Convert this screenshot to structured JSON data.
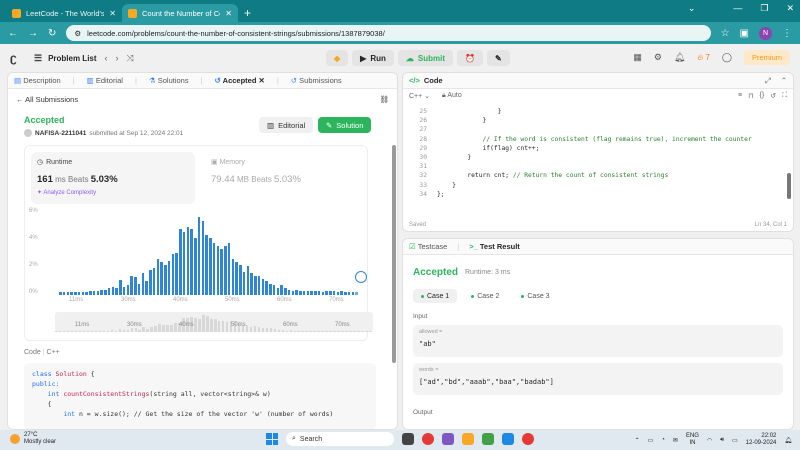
{
  "browser": {
    "tabs": [
      {
        "title": "LeetCode - The World's Leadin",
        "active": false
      },
      {
        "title": "Count the Number of Consistent",
        "active": true
      }
    ],
    "url": "leetcode.com/problems/count-the-number-of-consistent-strings/submissions/1387879038/",
    "profile_initial": "N"
  },
  "toolbar": {
    "problem_list": "Problem List",
    "run": "Run",
    "submit": "Submit",
    "streak": "7",
    "premium": "Premium"
  },
  "left": {
    "tabs": [
      "Description",
      "Editorial",
      "Solutions",
      "Accepted",
      "Submissions"
    ],
    "all_submissions": "All Submissions",
    "status": "Accepted",
    "user": "NAFISA-2211041",
    "submitted": "submitted at Sep 12, 2024 22:01",
    "editorial_btn": "Editorial",
    "solution_btn": "Solution",
    "runtime": {
      "label": "Runtime",
      "value": "161",
      "unit": "ms",
      "beats_label": "Beats",
      "beats": "5.03%",
      "analyze": "Analyze Complexity"
    },
    "memory": {
      "label": "Memory",
      "value": "79.44",
      "unit": "MB",
      "beats_label": "Beats",
      "beats": "5.03%"
    },
    "code_label": "Code",
    "code_lang": "C++"
  },
  "chart_data": {
    "type": "bar",
    "ylabel_ticks": [
      "6%",
      "4%",
      "2%",
      "0%"
    ],
    "xticks": [
      "11ms",
      "30ms",
      "40ms",
      "50ms",
      "60ms",
      "70ms"
    ],
    "ylim": [
      0,
      6
    ],
    "values": [
      0.2,
      0.2,
      0.2,
      0.2,
      0.2,
      0.25,
      0.2,
      0.25,
      0.3,
      0.3,
      0.3,
      0.35,
      0.4,
      0.5,
      0.6,
      0.5,
      1.1,
      0.6,
      0.7,
      1.4,
      1.3,
      0.8,
      1.6,
      1.0,
      1.8,
      2.0,
      2.6,
      2.4,
      2.2,
      2.5,
      3.0,
      3.1,
      4.8,
      4.6,
      5.0,
      4.8,
      4.2,
      5.7,
      5.4,
      4.4,
      4.2,
      3.8,
      3.6,
      3.4,
      3.6,
      3.8,
      2.6,
      2.4,
      2.2,
      1.7,
      2.1,
      1.6,
      1.4,
      1.4,
      1.2,
      1.0,
      0.8,
      0.7,
      0.5,
      0.7,
      0.5,
      0.4,
      0.3,
      0.4,
      0.3,
      0.3,
      0.3,
      0.3,
      0.3,
      0.3,
      0.2,
      0.3,
      0.3,
      0.3,
      0.2,
      0.3,
      0.2,
      0.2,
      0.2,
      0.2
    ],
    "highlight_index": 79
  },
  "code_snippet": {
    "line1_kw": "class",
    "line1_name": "Solution",
    "line1_rest": " {",
    "line2": "public:",
    "line3_type": "int",
    "line3_fn": "countConsistentStrings",
    "line3_rest": "(string all, vector<string>& w)",
    "line4": "    {",
    "line5_type": "int",
    "line5_rest": " n = w.size(); ",
    "line5_comment": "// Get the size of the vector 'w' (number of words)"
  },
  "editor": {
    "tab": "Code",
    "language": "C++",
    "mode": "Auto",
    "lines": [
      {
        "n": "25",
        "text": "                }"
      },
      {
        "n": "26",
        "text": "            }"
      },
      {
        "n": "27",
        "text": ""
      },
      {
        "n": "28",
        "text": "            // If the word is consistent (flag remains true), increment the counter"
      },
      {
        "n": "29",
        "text": "            if(flag) cnt++;"
      },
      {
        "n": "30",
        "text": "        }"
      },
      {
        "n": "31",
        "text": ""
      },
      {
        "n": "32",
        "text": "        return cnt; // Return the count of consistent strings"
      },
      {
        "n": "33",
        "text": "    }"
      },
      {
        "n": "34",
        "text": "};"
      }
    ],
    "saved": "Saved",
    "position": "Ln 34, Col 1"
  },
  "result": {
    "tabs": [
      "Testcase",
      "Test Result"
    ],
    "status": "Accepted",
    "runtime": "Runtime: 3 ms",
    "cases": [
      "Case 1",
      "Case 2",
      "Case 3"
    ],
    "input_label": "Input",
    "fields": [
      {
        "name": "allowed =",
        "value": "\"ab\""
      },
      {
        "name": "words =",
        "value": "[\"ad\",\"bd\",\"aaab\",\"baa\",\"badab\"]"
      }
    ],
    "output_label": "Output"
  },
  "taskbar": {
    "temp": "27°C",
    "weather": "Mostly clear",
    "search": "Search",
    "lang": "ENG",
    "region": "IN",
    "time": "22:02",
    "date": "12-09-2024"
  }
}
